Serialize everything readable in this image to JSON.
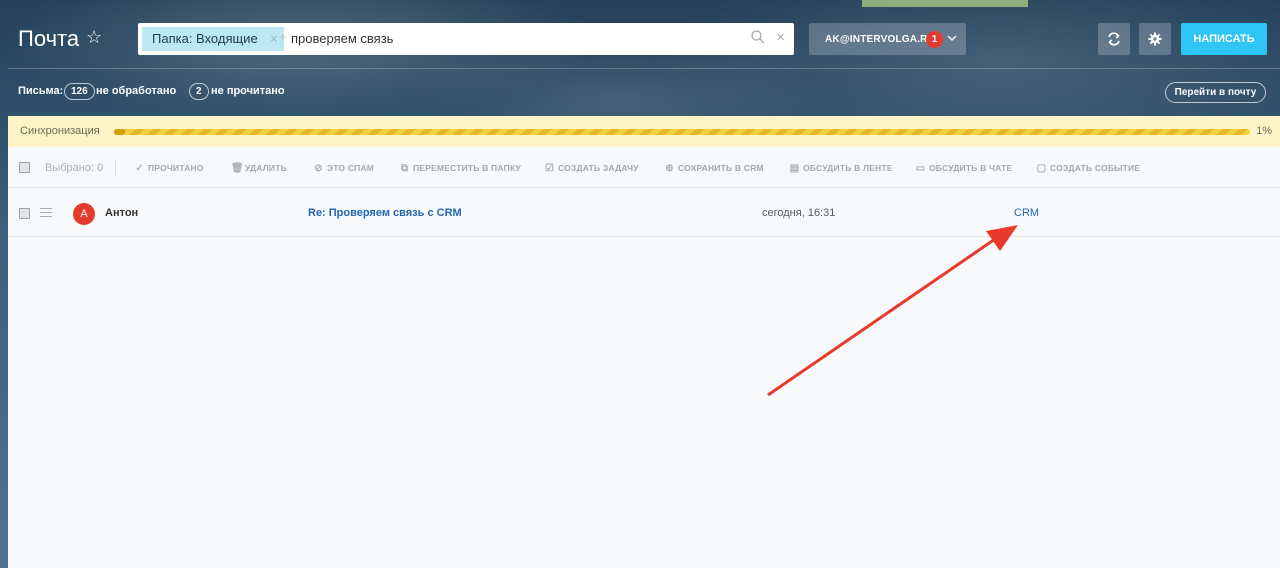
{
  "header": {
    "title": "Почта",
    "search": {
      "chip_label": "Папка: Входящие",
      "chip_close": "×",
      "plus": "+",
      "query": "проверяем связь",
      "clear": "×"
    },
    "account": {
      "label": "AK@INTERVOLGA.RU",
      "badge": "1"
    },
    "compose_label": "НАПИСАТЬ"
  },
  "counters": {
    "prefix": "Письма:",
    "unprocessed_count": "126",
    "unprocessed_label": "не обработано",
    "unread_count": "2",
    "unread_label": "не прочитано",
    "goto_label": "Перейти в почту"
  },
  "sync": {
    "label": "Синхронизация",
    "percent_text": "1%",
    "progress": 0.01
  },
  "toolbar": {
    "selected": "Выбрано: 0",
    "items": [
      {
        "label": "ПРОЧИТАНО",
        "icon": "check-icon"
      },
      {
        "label": "УДАЛИТЬ",
        "icon": "trash-icon"
      },
      {
        "label": "ЭТО СПАМ",
        "icon": "ban-icon"
      },
      {
        "label": "ПЕРЕМЕСТИТЬ В ПАПКУ",
        "icon": "folder-move-icon"
      },
      {
        "label": "СОЗДАТЬ ЗАДАЧУ",
        "icon": "task-icon"
      },
      {
        "label": "СОХРАНИТЬ В CRM",
        "icon": "plus-circle-icon"
      },
      {
        "label": "ОБСУДИТЬ В ЛЕНТЕ",
        "icon": "feed-icon"
      },
      {
        "label": "ОБСУДИТЬ В ЧАТЕ",
        "icon": "chat-icon"
      },
      {
        "label": "СОЗДАТЬ СОБЫТИЕ",
        "icon": "calendar-icon"
      }
    ]
  },
  "messages": [
    {
      "avatar_letter": "А",
      "from": "Антон",
      "subject": "Re: Проверяем связь с CRM",
      "date": "сегодня, 16:31",
      "crm": "CRM"
    }
  ],
  "colors": {
    "accent": "#2fc6f6",
    "badge": "#e53a2e",
    "link": "#2067b0",
    "annotation_arrow": "#e8392c"
  }
}
